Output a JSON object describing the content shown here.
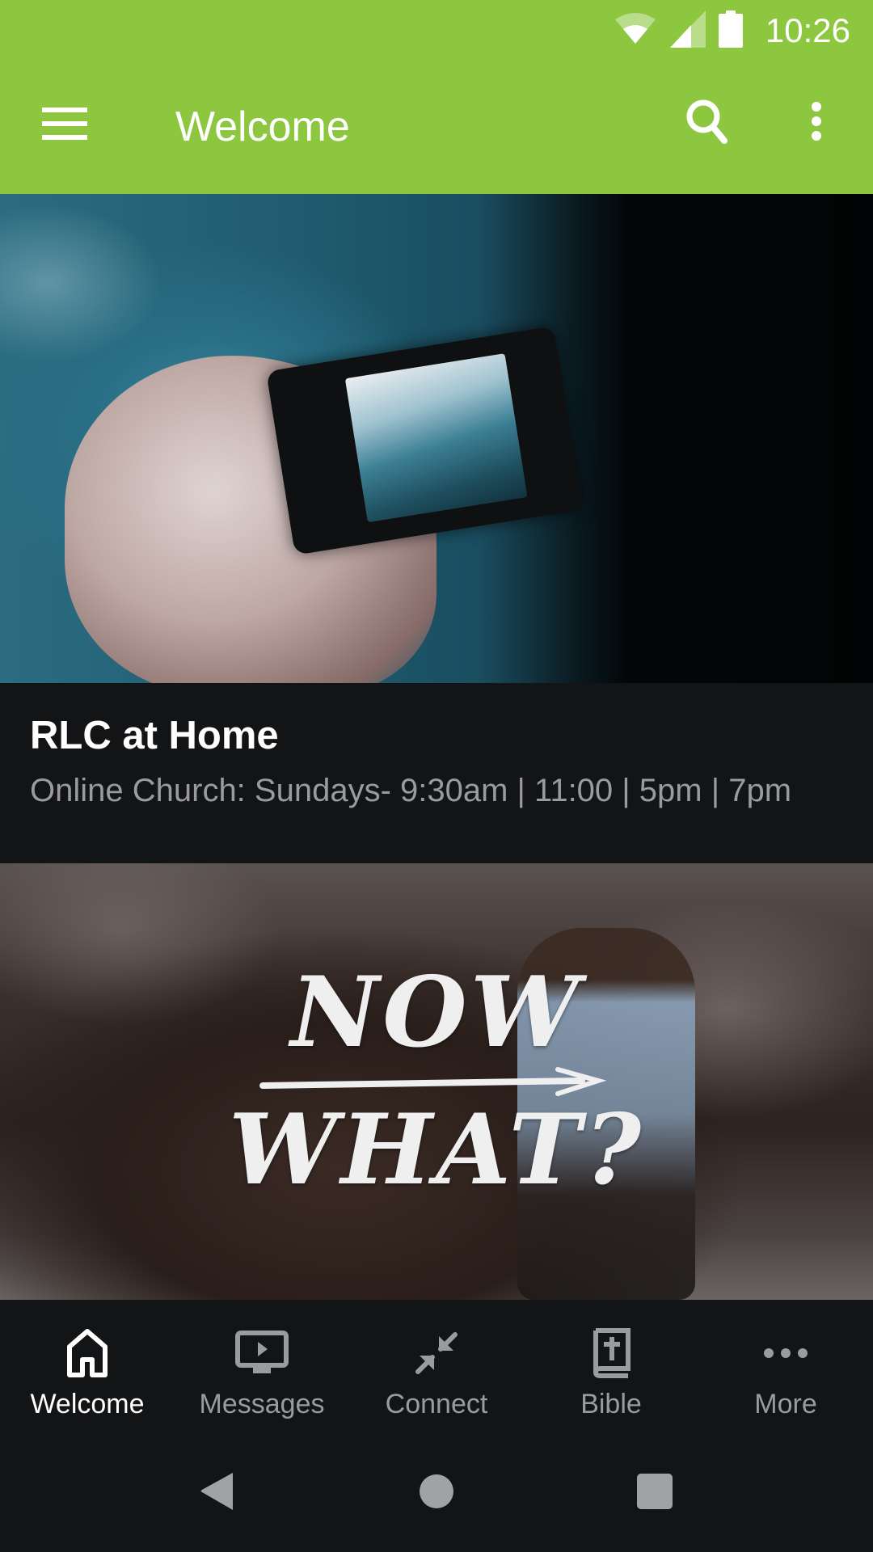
{
  "status_bar": {
    "time": "10:26",
    "icons": [
      "wifi-icon",
      "cellular-signal-icon",
      "battery-icon"
    ]
  },
  "app_bar": {
    "title": "Welcome",
    "menu_icon": "hamburger-menu-icon",
    "search_icon": "search-icon",
    "overflow_icon": "more-vert-icon",
    "background_color": "#8dc63f"
  },
  "cards": [
    {
      "title": "RLC at Home",
      "subtitle": "Online Church: Sundays- 9:30am | 11:00 | 5pm | 7pm",
      "image": "hand-holding-phone-photo"
    },
    {
      "image": "now-what-series-artwork",
      "image_text": [
        "NOW",
        "WHAT?"
      ]
    }
  ],
  "bottom_nav": {
    "active_index": 0,
    "items": [
      {
        "label": "Welcome",
        "icon": "home-icon"
      },
      {
        "label": "Messages",
        "icon": "video-play-icon"
      },
      {
        "label": "Connect",
        "icon": "connect-arrows-icon"
      },
      {
        "label": "Bible",
        "icon": "bible-icon"
      },
      {
        "label": "More",
        "icon": "more-horiz-icon"
      }
    ]
  },
  "system_nav": {
    "buttons": [
      "back-icon",
      "home-circle-icon",
      "recents-icon"
    ]
  }
}
